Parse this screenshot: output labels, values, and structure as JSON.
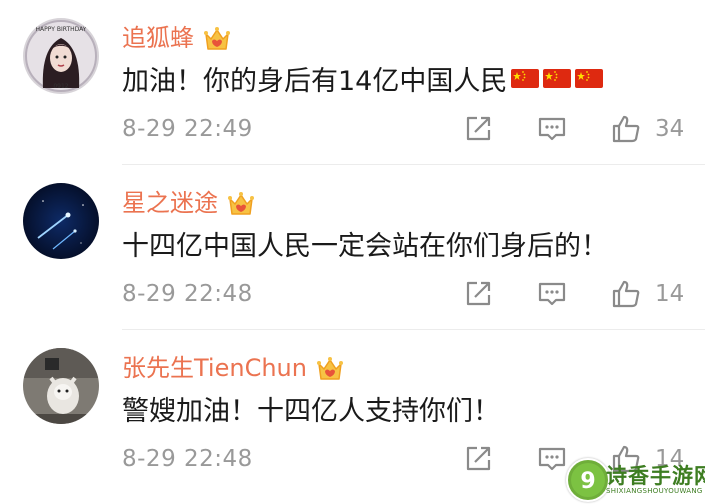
{
  "comments": [
    {
      "username": "追狐蜂",
      "text": "加油！你的身后有14亿中国人民",
      "flags": [
        "cn-flag-icon",
        "cn-flag-icon",
        "cn-flag-icon"
      ],
      "time": "8-29 22:49",
      "likes": "34"
    },
    {
      "username": "星之迷途",
      "text": "十四亿中国人民一定会站在你们身后的！",
      "time": "8-29 22:48",
      "likes": "14"
    },
    {
      "username": "张先生TienChun",
      "text": "警嫂加油！十四亿人支持你们！",
      "time": "8-29 22:48",
      "likes": "14"
    }
  ],
  "icons": {
    "forward": "share-icon",
    "reply": "comment-icon",
    "like": "thumbs-up-icon",
    "vip": "crown-icon"
  },
  "colors": {
    "username": "#eb7350",
    "text": "#1a1a1a",
    "meta": "#999999",
    "crown": "#f5a623"
  },
  "watermark": {
    "title": "诗香手游网",
    "subtitle": "SHIXIANGSHOUYOUWANG"
  }
}
